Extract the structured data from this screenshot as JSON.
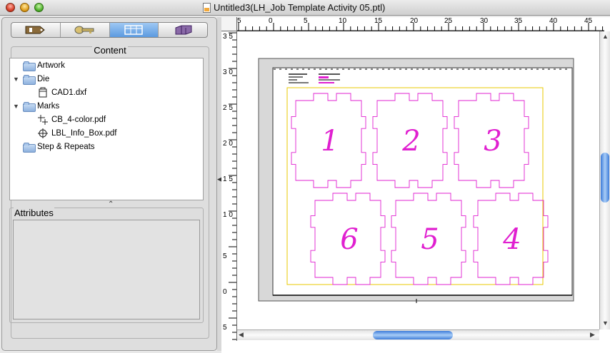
{
  "window": {
    "title": "Untitled3(LH_Job Template Activity 05.ptl)"
  },
  "tabs": [
    {
      "name": "info-tab",
      "icon": "tag-info-icon"
    },
    {
      "name": "resources-tab",
      "icon": "key-icon"
    },
    {
      "name": "layout-tab",
      "icon": "layout-grid-icon",
      "active": true
    },
    {
      "name": "stack-tab",
      "icon": "stack-icon"
    }
  ],
  "content": {
    "title": "Content",
    "tree": [
      {
        "label": "Artwork",
        "type": "folder",
        "level": 0,
        "expanded": false
      },
      {
        "label": "Die",
        "type": "folder",
        "level": 0,
        "expanded": true
      },
      {
        "label": "CAD1.dxf",
        "type": "die-file",
        "level": 1
      },
      {
        "label": "Marks",
        "type": "folder",
        "level": 0,
        "expanded": true
      },
      {
        "label": "CB_4-color.pdf",
        "type": "mark-file",
        "level": 1
      },
      {
        "label": "LBL_Info_Box.pdf",
        "type": "target-file",
        "level": 1
      },
      {
        "label": "Step & Repeats",
        "type": "folder",
        "level": 0,
        "expanded": false
      }
    ]
  },
  "attributes": {
    "title": "Attributes"
  },
  "ruler": {
    "h_ticks": [
      "5",
      "0",
      "5",
      "10",
      "15",
      "20",
      "25",
      "30",
      "35",
      "40",
      "45"
    ],
    "v_ticks": [
      "3 5",
      "3 0",
      "2 5",
      "2 0",
      "1 5",
      "1 0",
      "5",
      "0",
      "5"
    ]
  },
  "layout": {
    "panel_numbers": [
      "1",
      "2",
      "3",
      "6",
      "5",
      "4"
    ],
    "die_color": "#e020d0",
    "trim_color": "#e8c800"
  }
}
